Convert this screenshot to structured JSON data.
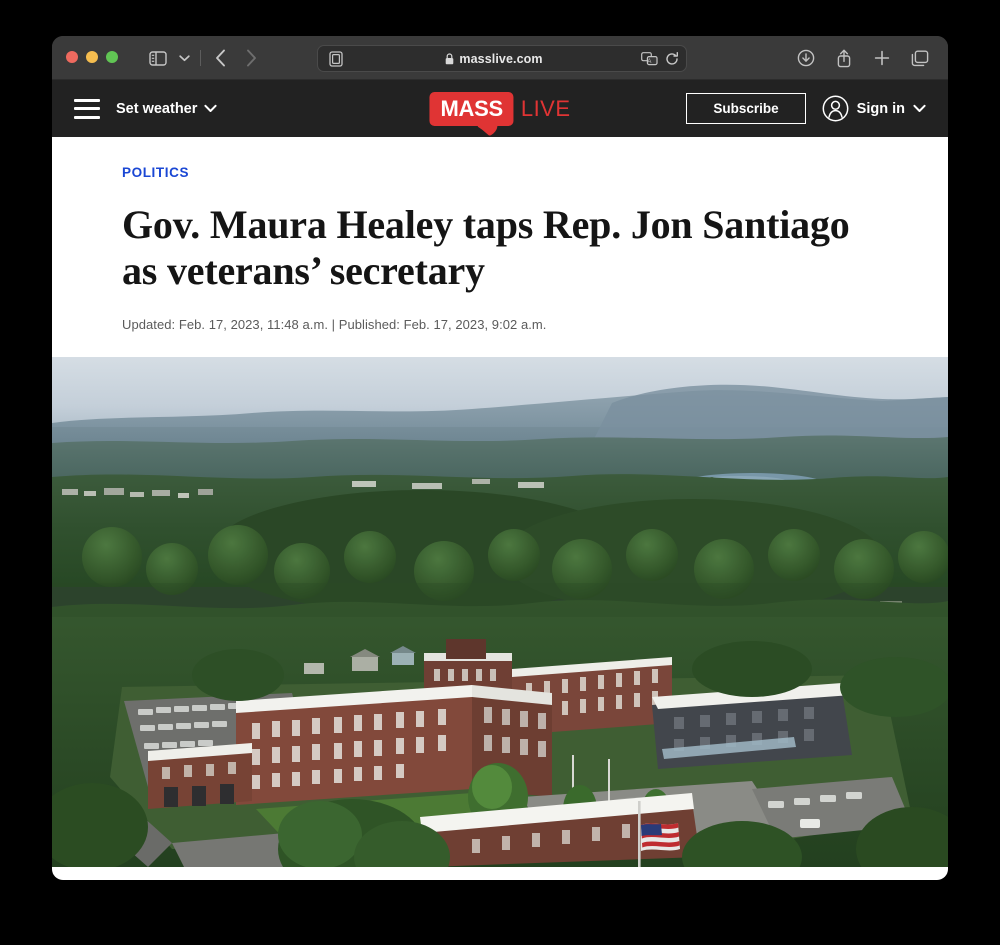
{
  "browser": {
    "url": "masslive.com",
    "secure_icon": "lock-icon",
    "reader_icon": "reader-mode-icon",
    "translate_icon": "translate-icon",
    "reload_icon": "reload-icon",
    "sidebar_icon": "sidebar-toggle-icon",
    "tab_overview_chevron": "chevron-down-icon",
    "back_icon": "back-arrow-icon",
    "forward_icon": "forward-arrow-icon",
    "shield_icon": "shield-privacy-icon",
    "download_icon": "download-icon",
    "share_icon": "share-icon",
    "new_tab_icon": "plus-icon",
    "tabs_icon": "tabs-overview-icon",
    "traffic_lights": [
      "close",
      "minimize",
      "zoom"
    ]
  },
  "site_header": {
    "menu_icon": "hamburger-menu-icon",
    "weather_label": "Set weather",
    "weather_chevron": "chevron-down-icon",
    "logo": {
      "primary": "MASS",
      "secondary": "LIVE",
      "brand_color": "#e03434"
    },
    "subscribe_label": "Subscribe",
    "account_icon": "user-avatar-icon",
    "signin_label": "Sign in",
    "signin_chevron": "chevron-down-icon",
    "background_color": "#222222"
  },
  "article": {
    "kicker": "POLITICS",
    "kicker_color": "#1a47d4",
    "headline": "Gov. Maura Healey taps Rep. Jon Santiago as veterans’ secretary",
    "timestamps": "Updated: Feb. 17, 2023, 11:48 a.m. | Published: Feb. 17, 2023, 9:02 a.m.",
    "hero_image": {
      "alt": "Aerial view of a large brick veterans hospital complex surrounded by dense green forest with rolling hills and a lake on the horizon",
      "sky_color": "#c9d3dd",
      "hills_color": "#7b909f",
      "forest_color": "#2f4a2e",
      "brick_color": "#7b4338",
      "roof_color": "#e9e9e6"
    }
  }
}
